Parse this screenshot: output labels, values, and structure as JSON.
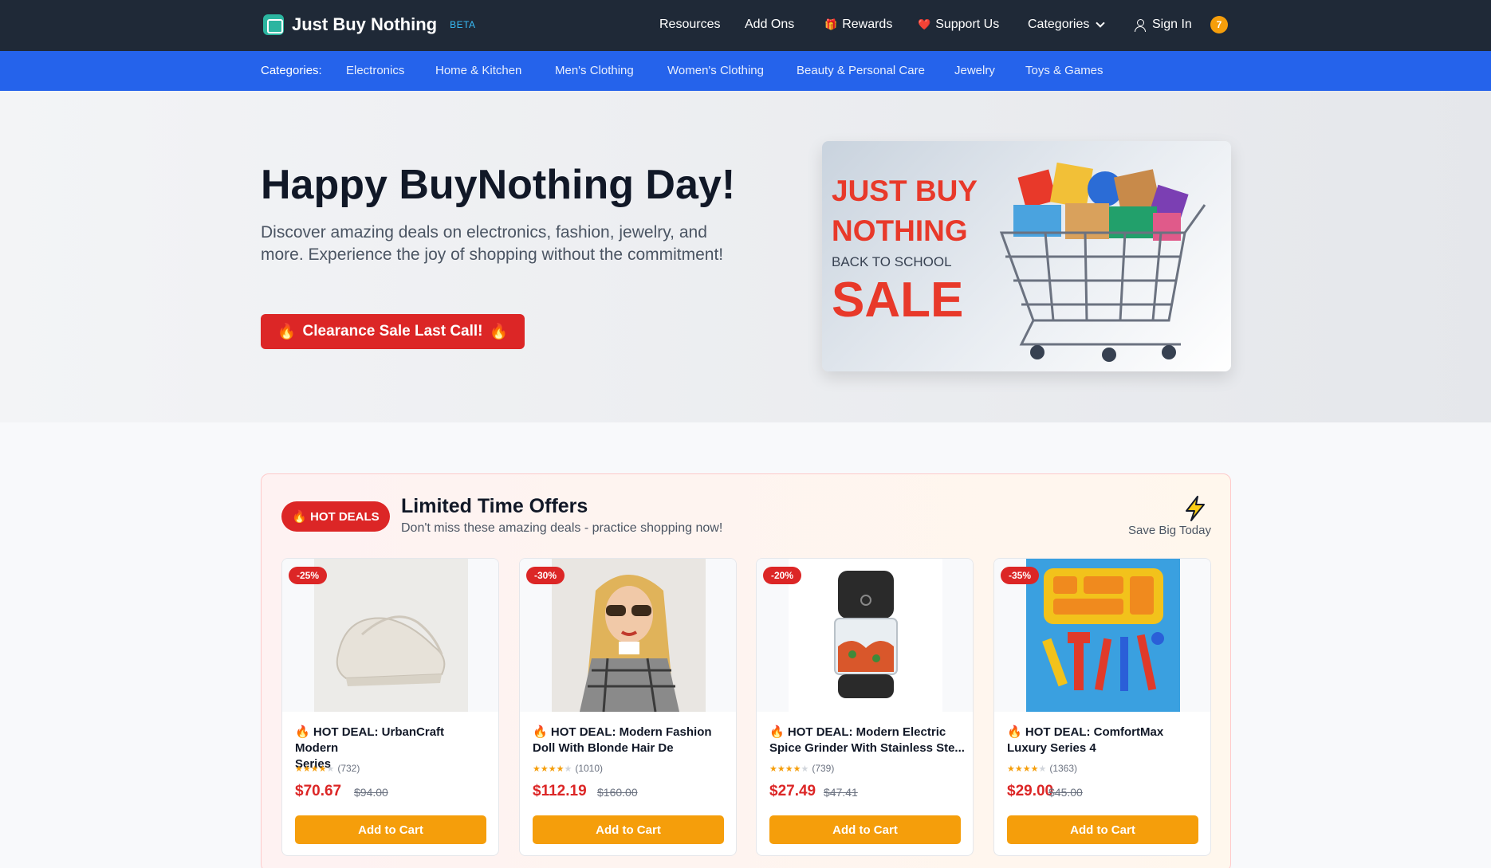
{
  "brand": {
    "name": "Just Buy Nothing",
    "beta": "BETA"
  },
  "nav": {
    "resources": "Resources",
    "add_ons": "Add Ons",
    "rewards": "Rewards",
    "support": "Support Us",
    "categories": "Categories",
    "sign_in": "Sign In",
    "badge": "7"
  },
  "catbar": {
    "lead": "Categories:",
    "items": [
      "Electronics",
      "Home & Kitchen",
      "Men's Clothing",
      "Women's Clothing",
      "Beauty & Personal Care",
      "Jewelry",
      "Toys & Games"
    ]
  },
  "hero": {
    "title": "Happy BuyNothing Day!",
    "subtitle": "Discover amazing deals on electronics, fashion, jewelry, and more. Experience the joy of shopping without the commitment!",
    "button": "Clearance Sale Last Call!",
    "promo": {
      "line1": "JUST BUY",
      "line2": "NOTHING",
      "line3": "BACK TO SCHOOL",
      "line4": "SALE"
    }
  },
  "deals": {
    "pill": "HOT DEALS",
    "title": "Limited Time Offers",
    "subtitle": "Don't miss these amazing deals - practice shopping now!",
    "save_big": "Save Big Today",
    "products": [
      {
        "discount": "-25%",
        "title_1": "HOT DEAL: UrbanCraft Modern",
        "title_2": "Series",
        "rating_count": "(732)",
        "rating": 4,
        "price": "$70.67",
        "old_price": "$94.00",
        "button": "Add to Cart",
        "image_icon": "sneaker-image"
      },
      {
        "discount": "-30%",
        "title_1": "HOT DEAL: Modern Fashion",
        "title_2": "Doll With Blonde Hair De",
        "rating_count": "(1010)",
        "rating": 4,
        "price": "$112.19",
        "old_price": "$160.00",
        "button": "Add to Cart",
        "image_icon": "doll-image"
      },
      {
        "discount": "-20%",
        "title_1": "HOT DEAL: Modern Electric",
        "title_2": "Spice Grinder With Stainless Ste...",
        "rating_count": "(739)",
        "rating": 4,
        "price": "$27.49",
        "old_price": "$47.41",
        "button": "Add to Cart",
        "image_icon": "grinder-image"
      },
      {
        "discount": "-35%",
        "title_1": "HOT DEAL: ComfortMax",
        "title_2": "Luxury Series 4",
        "rating_count": "(1363)",
        "rating": 4,
        "price": "$29.00",
        "old_price": "$45.00",
        "button": "Add to Cart",
        "image_icon": "toy-tools-image"
      }
    ]
  },
  "colors": {
    "topnav": "#1f2937",
    "catbar": "#2563eb",
    "accent_red": "#dc2626",
    "accent_orange": "#f59e0b"
  }
}
